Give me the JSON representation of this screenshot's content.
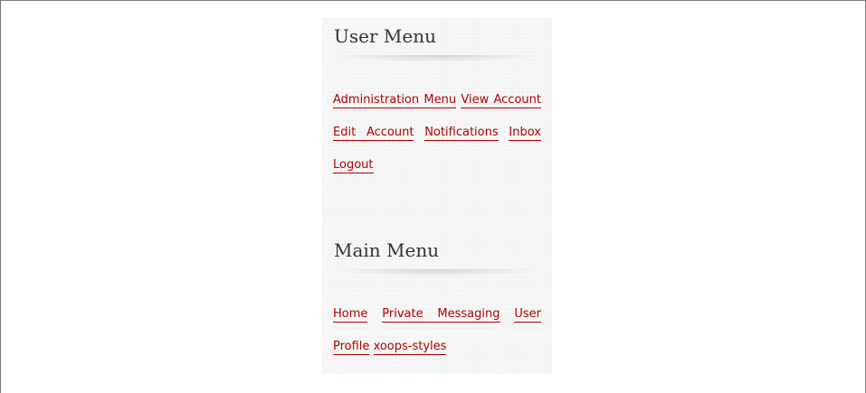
{
  "user_menu": {
    "title": "User Menu",
    "links": [
      {
        "label": "Administration Menu"
      },
      {
        "label": "View Account"
      },
      {
        "label": "Edit Account"
      },
      {
        "label": "Notifications"
      },
      {
        "label": "Inbox"
      },
      {
        "label": "Logout"
      }
    ]
  },
  "main_menu": {
    "title": "Main Menu",
    "links": [
      {
        "label": "Home"
      },
      {
        "label": "Private Messaging"
      },
      {
        "label": "User Profile"
      },
      {
        "label": "xoops-styles"
      }
    ]
  },
  "colors": {
    "link": "#b30000",
    "title": "#333333",
    "panel_background": "#f6f6f6"
  }
}
